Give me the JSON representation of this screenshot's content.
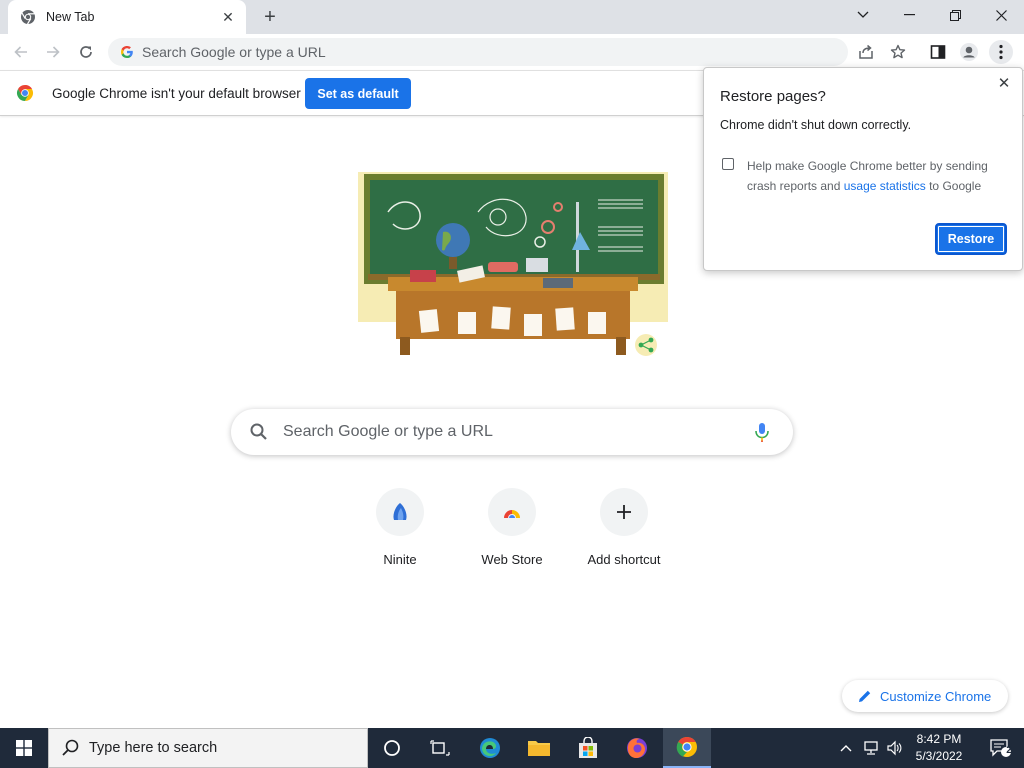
{
  "browser": {
    "tab": {
      "title": "New Tab",
      "close_glyph": "✕"
    },
    "new_tab_glyph": "+",
    "window_controls": {
      "dropdown_glyph": "⌵",
      "minimize_glyph": "—",
      "restore_glyph": "❐",
      "close_glyph": "✕"
    },
    "omnibox_placeholder": "Search Google or type a URL"
  },
  "infobar": {
    "message": "Google Chrome isn't your default browser",
    "button_label": "Set as default"
  },
  "ntp": {
    "search_placeholder": "Search Google or type a URL",
    "shortcuts": [
      {
        "label": "Ninite",
        "icon": "ninite-icon"
      },
      {
        "label": "Web Store",
        "icon": "web-store-icon"
      },
      {
        "label": "Add shortcut",
        "icon": "plus-icon"
      }
    ],
    "customize_label": "Customize Chrome"
  },
  "restore_popup": {
    "title": "Restore pages?",
    "message": "Chrome didn't shut down correctly.",
    "help_prefix": "Help make Google Chrome better by sending crash reports and ",
    "help_link": "usage statistics",
    "help_suffix": " to Google",
    "checkbox_checked": false,
    "close_glyph": "✕",
    "button_label": "Restore"
  },
  "taskbar": {
    "search_placeholder": "Type here to search",
    "time": "8:42 PM",
    "date": "5/3/2022",
    "notification_count": "2"
  },
  "colors": {
    "accent": "#1a73e8",
    "tabstrip": "#dee1e6",
    "taskbar": "#1f2a3a"
  }
}
